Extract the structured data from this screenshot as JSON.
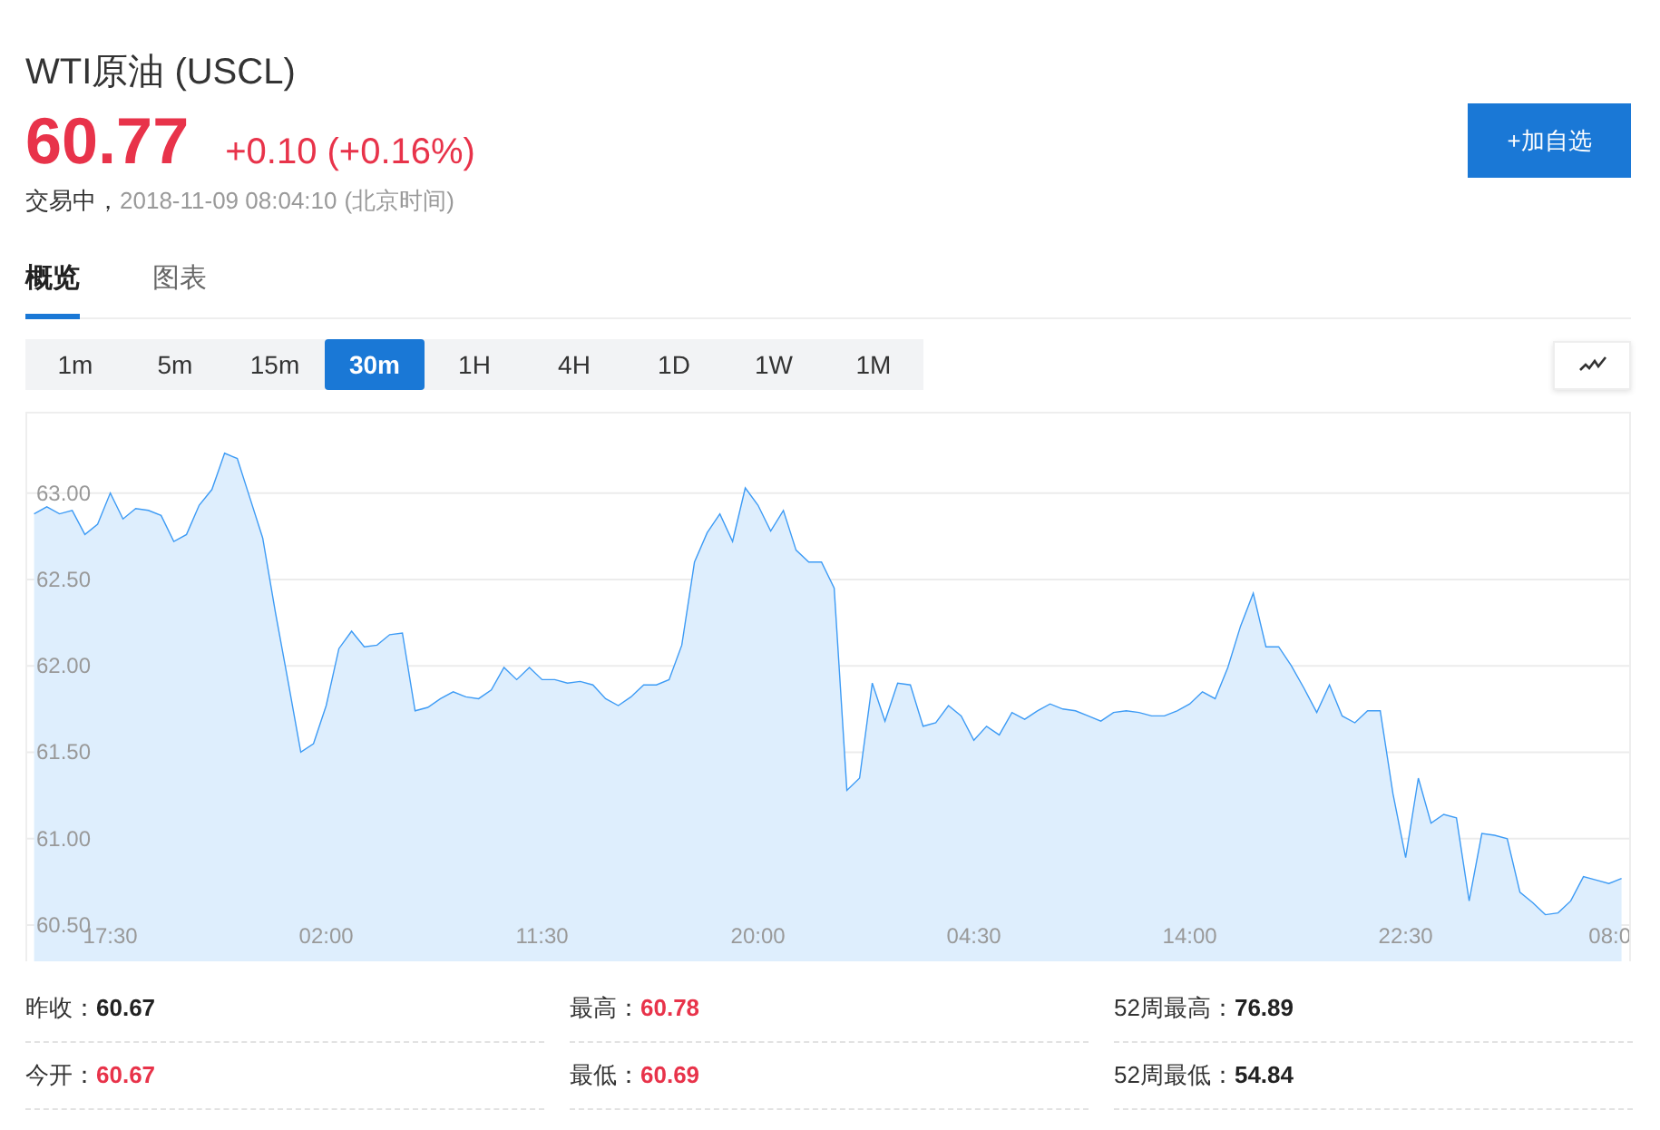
{
  "header": {
    "title": "WTI原油 (USCL)",
    "price": "60.77",
    "change": "+0.10 (+0.16%)",
    "status": "交易中，",
    "timestamp": "2018-11-09 08:04:10",
    "timezone": "(北京时间)",
    "watch_button": "+加自选"
  },
  "tabs": [
    {
      "label": "概览",
      "selected": true
    },
    {
      "label": "图表",
      "selected": false
    }
  ],
  "intervals": [
    {
      "label": "1m",
      "selected": false
    },
    {
      "label": "5m",
      "selected": false
    },
    {
      "label": "15m",
      "selected": false
    },
    {
      "label": "30m",
      "selected": true
    },
    {
      "label": "1H",
      "selected": false
    },
    {
      "label": "4H",
      "selected": false
    },
    {
      "label": "1D",
      "selected": false
    },
    {
      "label": "1W",
      "selected": false
    },
    {
      "label": "1M",
      "selected": false
    }
  ],
  "chart": {
    "chart_data": {
      "type": "area",
      "grid": true,
      "categories": [
        null,
        null,
        null,
        null,
        null,
        null,
        "17:30",
        null,
        null,
        null,
        null,
        null,
        null,
        null,
        null,
        null,
        null,
        null,
        null,
        null,
        null,
        null,
        null,
        "02:00",
        null,
        null,
        null,
        null,
        null,
        null,
        null,
        null,
        null,
        null,
        null,
        null,
        null,
        null,
        null,
        null,
        "11:30",
        null,
        null,
        null,
        null,
        null,
        null,
        null,
        null,
        null,
        null,
        null,
        null,
        null,
        null,
        null,
        null,
        "20:00",
        null,
        null,
        null,
        null,
        null,
        null,
        null,
        null,
        null,
        null,
        null,
        null,
        null,
        null,
        null,
        null,
        "04:30",
        null,
        null,
        null,
        null,
        null,
        null,
        null,
        null,
        null,
        null,
        null,
        null,
        null,
        null,
        null,
        null,
        "14:00",
        null,
        null,
        null,
        null,
        null,
        null,
        null,
        null,
        null,
        null,
        null,
        null,
        null,
        null,
        null,
        null,
        "22:30",
        null,
        null,
        null,
        null,
        null,
        null,
        null,
        null,
        null,
        null,
        null,
        null,
        null,
        null,
        null,
        null,
        "08:0"
      ],
      "ylim": [
        60.29,
        63.46
      ],
      "yticks": [
        {
          "value": 60.5,
          "label": "60.50"
        },
        {
          "value": 61,
          "label": "61.00"
        },
        {
          "value": 61.5,
          "label": "61.50"
        },
        {
          "value": 62,
          "label": "62.00"
        },
        {
          "value": 62.5,
          "label": "62.50"
        },
        {
          "value": 63,
          "label": "63.00"
        }
      ],
      "series": [
        {
          "color": "#3d9bf5",
          "values": [
            62.88,
            62.92,
            62.88,
            62.9,
            62.76,
            62.82,
            63.0,
            62.85,
            62.91,
            62.9,
            62.87,
            62.72,
            62.76,
            62.93,
            63.02,
            63.23,
            63.2,
            62.97,
            62.74,
            62.31,
            61.91,
            61.5,
            61.55,
            61.77,
            62.1,
            62.2,
            62.11,
            62.12,
            62.18,
            62.19,
            61.74,
            61.76,
            61.81,
            61.85,
            61.82,
            61.81,
            61.86,
            61.99,
            61.92,
            61.99,
            61.92,
            61.92,
            61.9,
            61.91,
            61.89,
            61.81,
            61.77,
            61.82,
            61.89,
            61.89,
            61.92,
            62.12,
            62.6,
            62.77,
            62.88,
            62.72,
            63.03,
            62.93,
            62.78,
            62.9,
            62.67,
            62.6,
            62.6,
            62.45,
            61.28,
            61.35,
            61.9,
            61.68,
            61.9,
            61.89,
            61.65,
            61.67,
            61.77,
            61.71,
            61.57,
            61.65,
            61.6,
            61.73,
            61.69,
            61.74,
            61.78,
            61.75,
            61.74,
            61.71,
            61.68,
            61.73,
            61.74,
            61.73,
            61.71,
            61.71,
            61.74,
            61.78,
            61.85,
            61.81,
            61.99,
            62.23,
            62.42,
            62.11,
            62.11,
            62.0,
            61.87,
            61.73,
            61.89,
            61.71,
            61.67,
            61.74,
            61.74,
            61.26,
            60.89,
            61.35,
            61.09,
            61.14,
            61.12,
            60.64,
            61.03,
            61.02,
            61.0,
            60.69,
            60.63,
            60.56,
            60.57,
            60.64,
            60.78,
            60.76,
            60.74,
            60.77
          ]
        }
      ]
    }
  },
  "stats": [
    {
      "label": "昨收：",
      "value": "60.67",
      "color": "#222222"
    },
    {
      "label": "最高：",
      "value": "60.78",
      "color": "#e8334a"
    },
    {
      "label": "52周最高：",
      "value": "76.89",
      "color": "#222222"
    },
    {
      "label": "今开：",
      "value": "60.67",
      "color": "#e8334a"
    },
    {
      "label": "最低：",
      "value": "60.69",
      "color": "#e8334a"
    },
    {
      "label": "52周最低：",
      "value": "54.84",
      "color": "#222222"
    }
  ]
}
